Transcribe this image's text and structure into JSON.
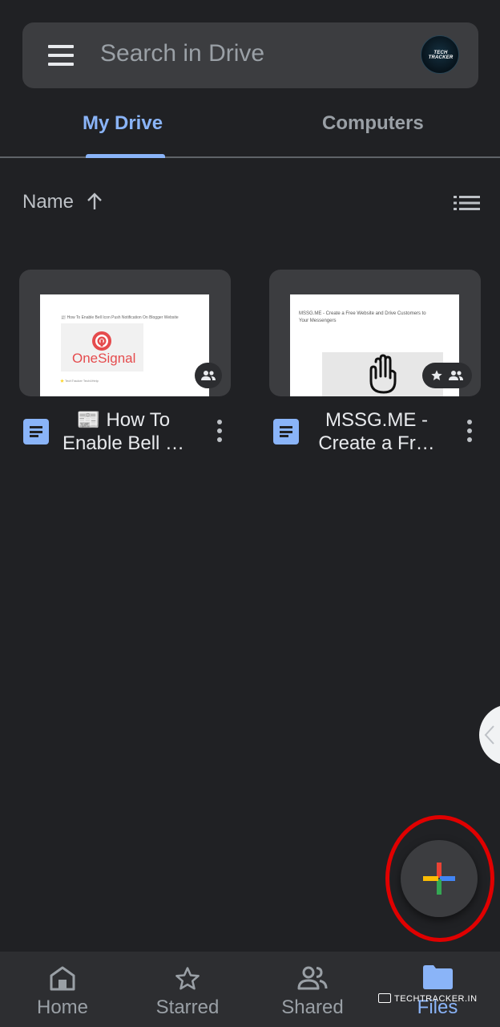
{
  "search": {
    "placeholder": "Search in Drive",
    "avatar_text": "TECH TRACKER"
  },
  "tabs": [
    {
      "label": "My Drive",
      "selected": true
    },
    {
      "label": "Computers",
      "selected": false
    }
  ],
  "sort": {
    "label": "Name",
    "direction": "ascending"
  },
  "files": [
    {
      "title": "📰 How To Enable Bell …",
      "type": "Google Docs",
      "shared": true,
      "starred": false,
      "thumbnail": {
        "heading": "📰 How To Enable Bell Icon Push Notification On Blogger Website",
        "logo_text": "OneSignal",
        "footer": "⭐ TechTracker  Tech4Help"
      }
    },
    {
      "title": "MSSG.ME - Create a Fr…",
      "type": "Google Docs",
      "shared": true,
      "starred": true,
      "thumbnail": {
        "heading": "MSSG.ME - Create a Free Website and Drive Customers to Your Messengers"
      }
    }
  ],
  "bottom_nav": [
    {
      "label": "Home",
      "icon": "home-icon",
      "active": false
    },
    {
      "label": "Starred",
      "icon": "star-outline-icon",
      "active": false
    },
    {
      "label": "Shared",
      "icon": "people-icon",
      "active": false
    },
    {
      "label": "Files",
      "icon": "folder-icon",
      "active": true
    }
  ],
  "watermark": "TECHTRACKER.IN",
  "colors": {
    "background": "#202124",
    "surface": "#3c3d40",
    "accent": "#8ab4f8",
    "annotation": "#e00000"
  }
}
